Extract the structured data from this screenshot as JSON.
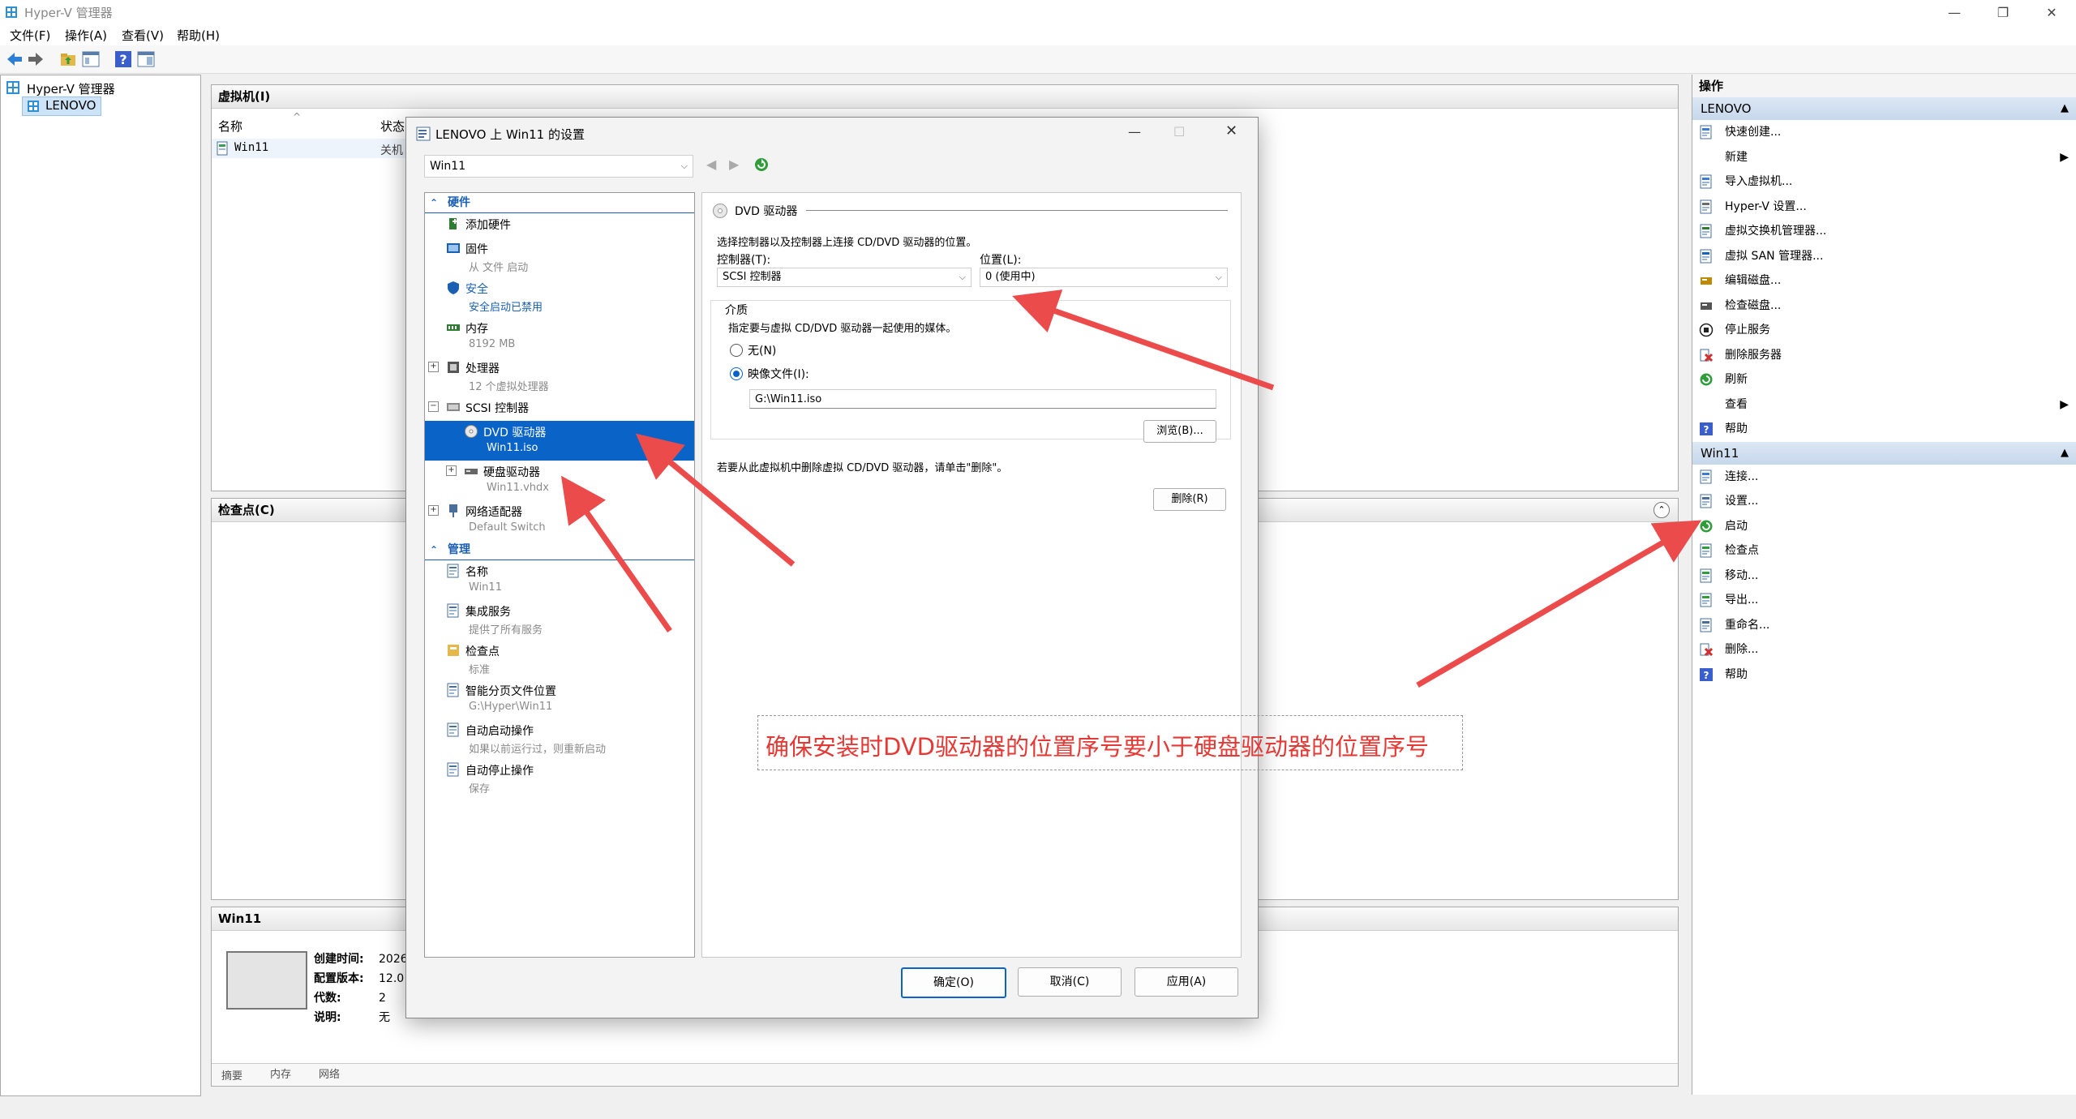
{
  "window": {
    "title": "Hyper-V 管理器"
  },
  "menu": [
    "文件(F)",
    "操作(A)",
    "查看(V)",
    "帮助(H)"
  ],
  "toolbar": {
    "icons": [
      "back-arrow-icon",
      "forward-arrow-icon",
      "folder-up-icon",
      "console-tree-icon",
      "help-icon",
      "panel-icon"
    ]
  },
  "tree": {
    "root": "Hyper-V 管理器",
    "server": "LENOVO"
  },
  "vm_pane": {
    "title": "虚拟机(I)",
    "columns": [
      "名称",
      "状态"
    ],
    "rows": [
      {
        "name": "Win11",
        "state": "关机"
      }
    ]
  },
  "checkpoint_pane": {
    "title": "检查点(C)"
  },
  "details_pane": {
    "title": "Win11",
    "fields": [
      {
        "label": "创建时间:",
        "value": "2026"
      },
      {
        "label": "配置版本:",
        "value": "12.0"
      },
      {
        "label": "代数:",
        "value": "2"
      },
      {
        "label": "说明:",
        "value": "无"
      }
    ],
    "tabs": [
      "摘要",
      "内存",
      "网络"
    ]
  },
  "actions": {
    "header": "操作",
    "sections": [
      {
        "title": "LENOVO",
        "items": [
          {
            "label": "快速创建...",
            "icon": "quick-create-icon",
            "color": "#3a7bd5"
          },
          {
            "label": "新建",
            "icon": "",
            "submenu": true
          },
          {
            "label": "导入虚拟机...",
            "icon": "import-vm-icon",
            "color": "#3a7bd5"
          },
          {
            "label": "Hyper-V 设置...",
            "icon": "settings-page-icon",
            "color": "#6a6a6a"
          },
          {
            "label": "虚拟交换机管理器...",
            "icon": "switch-manager-icon",
            "color": "#2f7d32"
          },
          {
            "label": "虚拟 SAN 管理器...",
            "icon": "san-manager-icon",
            "color": "#1565c0"
          },
          {
            "label": "编辑磁盘...",
            "icon": "edit-disk-icon",
            "color": "#c08a00"
          },
          {
            "label": "检查磁盘...",
            "icon": "inspect-disk-icon",
            "color": "#555555"
          },
          {
            "label": "停止服务",
            "icon": "stop-service-icon",
            "color": "#222222"
          },
          {
            "label": "删除服务器",
            "icon": "remove-server-icon",
            "color": "#d32f2f"
          },
          {
            "label": "刷新",
            "icon": "refresh-icon",
            "color": "#2e9d3a"
          },
          {
            "label": "查看",
            "icon": "",
            "submenu": true
          },
          {
            "label": "帮助",
            "icon": "help-icon",
            "color": "#3a5fcd"
          }
        ]
      },
      {
        "title": "Win11",
        "items": [
          {
            "label": "连接...",
            "icon": "connect-icon",
            "color": "#3a7bd5"
          },
          {
            "label": "设置...",
            "icon": "settings-icon",
            "color": "#4a6f9a"
          },
          {
            "label": "启动",
            "icon": "start-icon",
            "color": "#2e9d3a"
          },
          {
            "label": "检查点",
            "icon": "checkpoint-icon",
            "color": "#2e9d3a"
          },
          {
            "label": "移动...",
            "icon": "move-icon",
            "color": "#2e9d3a"
          },
          {
            "label": "导出...",
            "icon": "export-icon",
            "color": "#2e9d3a"
          },
          {
            "label": "重命名...",
            "icon": "rename-icon",
            "color": "#4a6f9a"
          },
          {
            "label": "删除...",
            "icon": "delete-icon",
            "color": "#d32f2f"
          },
          {
            "label": "帮助",
            "icon": "help-icon",
            "color": "#3a5fcd"
          }
        ]
      }
    ]
  },
  "dialog": {
    "title": "LENOVO 上 Win11 的设置",
    "vm_select": "Win11",
    "nav": {
      "hardware_label": "硬件",
      "management_label": "管理",
      "hardware": [
        {
          "label": "添加硬件",
          "sub": "",
          "icon": "add-hardware-icon",
          "indent": 0,
          "expander": ""
        },
        {
          "label": "固件",
          "sub": "从 文件 启动",
          "icon": "firmware-icon",
          "indent": 0,
          "expander": ""
        },
        {
          "label": "安全",
          "sub": "安全启动已禁用",
          "icon": "security-shield-icon",
          "indent": 0,
          "expander": "",
          "blue": true
        },
        {
          "label": "内存",
          "sub": "8192 MB",
          "icon": "memory-icon",
          "indent": 0,
          "expander": ""
        },
        {
          "label": "处理器",
          "sub": "12 个虚拟处理器",
          "icon": "processor-icon",
          "indent": 0,
          "expander": "+"
        },
        {
          "label": "SCSI 控制器",
          "sub": "",
          "icon": "scsi-controller-icon",
          "indent": 0,
          "expander": "−"
        },
        {
          "label": "DVD 驱动器",
          "sub": "Win11.iso",
          "icon": "dvd-drive-icon",
          "indent": 1,
          "expander": "",
          "selected": true
        },
        {
          "label": "硬盘驱动器",
          "sub": "Win11.vhdx",
          "icon": "hard-disk-icon",
          "indent": 1,
          "expander": "+"
        },
        {
          "label": "网络适配器",
          "sub": "Default Switch",
          "icon": "network-adapter-icon",
          "indent": 0,
          "expander": "+"
        }
      ],
      "management": [
        {
          "label": "名称",
          "sub": "Win11",
          "icon": "name-icon"
        },
        {
          "label": "集成服务",
          "sub": "提供了所有服务",
          "icon": "integration-services-icon"
        },
        {
          "label": "检查点",
          "sub": "标准",
          "icon": "checkpoint-icon"
        },
        {
          "label": "智能分页文件位置",
          "sub": "G:\\Hyper\\Win11",
          "icon": "smart-paging-icon"
        },
        {
          "label": "自动启动操作",
          "sub": "如果以前运行过，则重新启动",
          "icon": "auto-start-icon"
        },
        {
          "label": "自动停止操作",
          "sub": "保存",
          "icon": "auto-stop-icon"
        }
      ]
    },
    "content": {
      "section_title": "DVD 驱动器",
      "description": "选择控制器以及控制器上连接 CD/DVD 驱动器的位置。",
      "controller_label": "控制器(T):",
      "controller_value": "SCSI 控制器",
      "location_label": "位置(L):",
      "location_value": "0 (使用中)",
      "media_label": "介质",
      "media_description": "指定要与虚拟 CD/DVD 驱动器一起使用的媒体。",
      "none_option": "无(N)",
      "image_option": "映像文件(I):",
      "image_path": "G:\\Win11.iso",
      "browse_button": "浏览(B)...",
      "remove_hint": "若要从此虚拟机中删除虚拟 CD/DVD 驱动器，请单击\"删除\"。",
      "remove_button": "删除(R)"
    },
    "buttons": {
      "ok": "确定(O)",
      "cancel": "取消(C)",
      "apply": "应用(A)"
    }
  },
  "annotation": {
    "text": "确保安装时DVD驱动器的位置序号要小于硬盘驱动器的位置序号",
    "color": "#e53935"
  }
}
